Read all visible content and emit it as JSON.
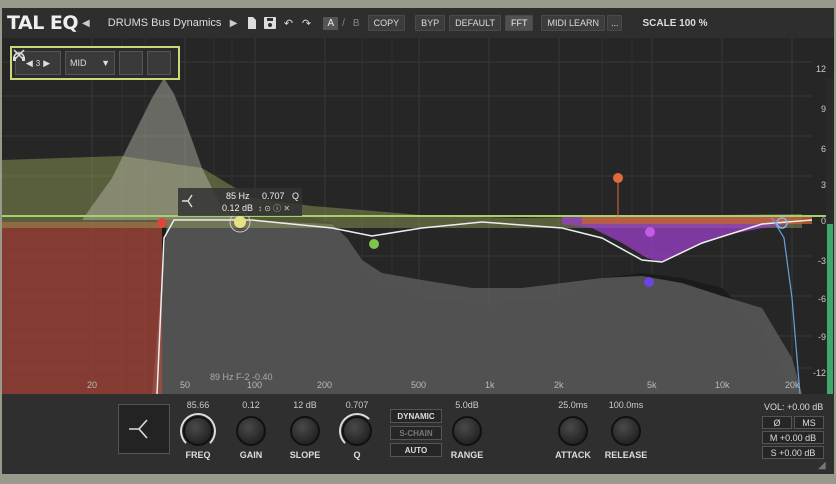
{
  "header": {
    "logo": "TAL EQ",
    "preset_name": "DRUMS Bus Dynamics",
    "a_label": "A",
    "b_label": "B",
    "copy_label": "COPY",
    "byp_label": "BYP",
    "default_label": "DEFAULT",
    "fft_label": "FFT",
    "midi_learn_label": "MIDI LEARN",
    "more_label": "...",
    "scale_label": "SCALE 100 %"
  },
  "band_control": {
    "band_number": "3",
    "mode": "MID"
  },
  "tooltip": {
    "freq": "85 Hz",
    "q": "0.707",
    "q_label": "Q",
    "gain": "0.12 dB"
  },
  "hint": "89 Hz F-2 -0.40",
  "db_scale": [
    "12",
    "9",
    "6",
    "3",
    "0",
    "-3",
    "-6",
    "-9",
    "-12"
  ],
  "freq_scale": [
    "20",
    "50",
    "100",
    "200",
    "500",
    "1k",
    "2k",
    "5k",
    "10k",
    "20k"
  ],
  "controls": {
    "freq_value": "85.66",
    "freq_label": "FREQ",
    "gain_value": "0.12",
    "gain_label": "GAIN",
    "slope_value": "12 dB",
    "slope_label": "SLOPE",
    "q_value": "0.707",
    "q_label": "Q",
    "dynamic_label": "DYNAMIC",
    "schain_label": "S-CHAIN",
    "auto_label": "AUTO",
    "range_value": "5.0dB",
    "range_label": "RANGE",
    "attack_value": "25.0ms",
    "attack_label": "ATTACK",
    "release_value": "100.0ms",
    "release_label": "RELEASE"
  },
  "output": {
    "vol": "VOL: +0.00 dB",
    "phase_icon": "Ø",
    "ms_label": "MS",
    "m_gain": "M +0.00 dB",
    "s_gain": "S +0.00 dB"
  },
  "colors": {
    "accent_band": "#cfd57a",
    "band_red": "#d9483b",
    "band_yellow": "#e6e08a",
    "band_green": "#7ec64a",
    "band_orange": "#e06a3c",
    "band_purple": "#a245d8",
    "band_blue": "#6a8fe0",
    "band_light_blue": "#8ab4d8",
    "output_meter": "#3fa86a"
  }
}
